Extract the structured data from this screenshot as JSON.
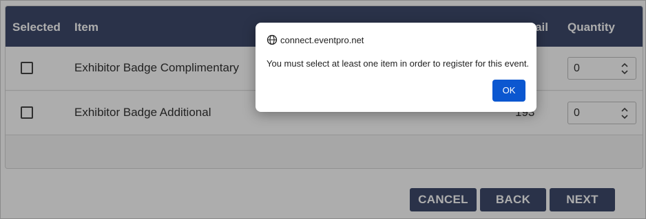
{
  "table": {
    "headers": {
      "selected": "Selected",
      "item": "Item",
      "available": "Avail",
      "quantity": "Quantity"
    },
    "rows": [
      {
        "selected": false,
        "item": "Exhibitor Badge Complimentary",
        "available": "",
        "quantity": "0"
      },
      {
        "selected": false,
        "item": "Exhibitor Badge Additional",
        "available": "193",
        "quantity": "0"
      }
    ]
  },
  "buttons": {
    "cancel": "CANCEL",
    "back": "BACK",
    "next": "NEXT"
  },
  "dialog": {
    "origin": "connect.eventpro.net",
    "message": "You must select at least one item in order to register for this event.",
    "ok_label": "OK"
  },
  "icons": {
    "origin": "globe-icon",
    "quantity_spinner": "spinner-up-down-icon",
    "checkbox": "checkbox-icon"
  },
  "colors": {
    "header_bg": "#3e4b6c",
    "button_bg": "#3e4b6c",
    "dialog_ok": "#0b57d0"
  }
}
